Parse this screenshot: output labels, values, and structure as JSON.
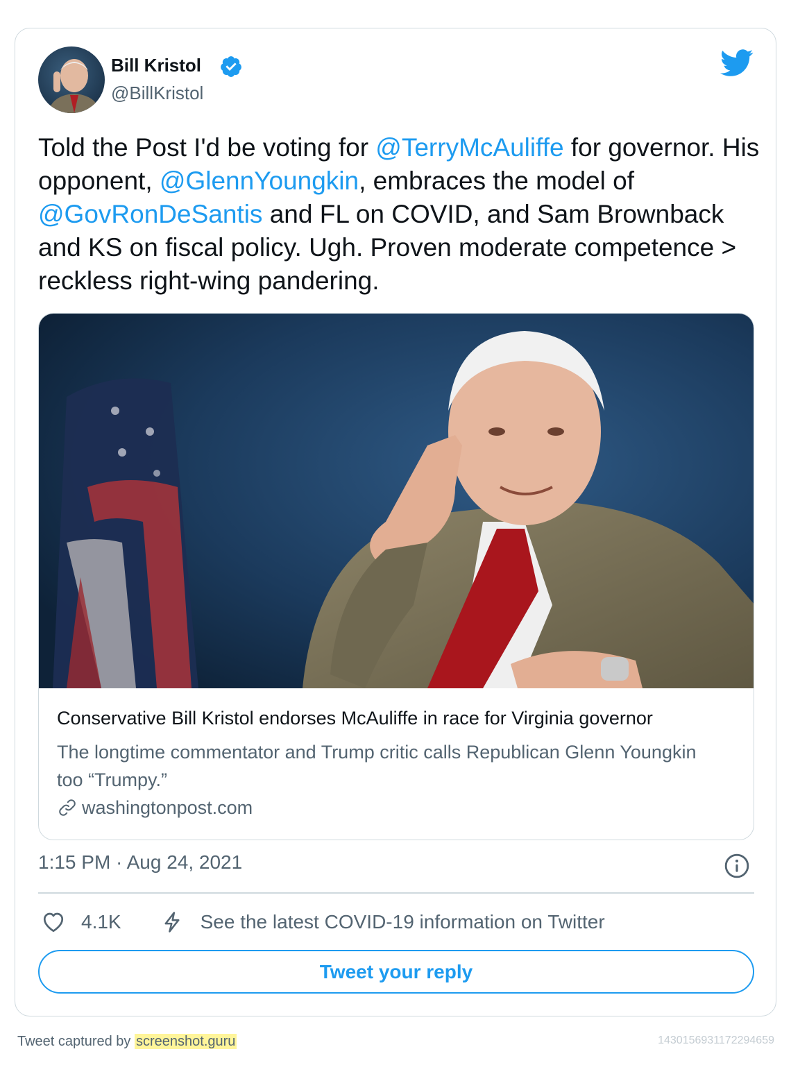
{
  "author": {
    "name": "Bill Kristol",
    "handle": "@BillKristol",
    "verified": true
  },
  "tweet": {
    "segments": [
      {
        "text": "Told the Post I'd be voting for ",
        "type": "text"
      },
      {
        "text": "@TerryMcAuliffe",
        "type": "mention"
      },
      {
        "text": " for governor. His opponent, ",
        "type": "text"
      },
      {
        "text": "@GlennYoungkin",
        "type": "mention"
      },
      {
        "text": ", embraces the model of ",
        "type": "text"
      },
      {
        "text": "@GovRonDeSantis",
        "type": "mention"
      },
      {
        "text": " and FL on COVID, and Sam Brownback and KS on fiscal policy. Ugh. Proven moderate competence > reckless right-wing pandering.",
        "type": "text"
      }
    ]
  },
  "link_card": {
    "title": "Conservative Bill Kristol endorses McAuliffe in race for Virginia governor",
    "description": "The longtime commentator and Trump critic calls Republican Glenn Youngkin too “Trumpy.”",
    "domain": "washingtonpost.com"
  },
  "meta": {
    "timestamp": "1:15 PM · Aug 24, 2021"
  },
  "actions": {
    "like_count": "4.1K",
    "covid_info": "See the latest COVID-19 information on Twitter"
  },
  "reply_button_label": "Tweet your reply",
  "footer": {
    "captured_by": "Tweet captured by ",
    "brand": "screenshot.guru",
    "tweet_id": "1430156931172294659"
  },
  "colors": {
    "accent": "#1d9bf0",
    "text": "#0f1419",
    "secondary_text": "#536471",
    "border": "#cfd9de",
    "highlight": "#fff59a"
  },
  "icons": [
    "verified-badge-icon",
    "twitter-bird-icon",
    "link-icon",
    "info-icon",
    "heart-icon",
    "lightning-bolt-icon"
  ]
}
